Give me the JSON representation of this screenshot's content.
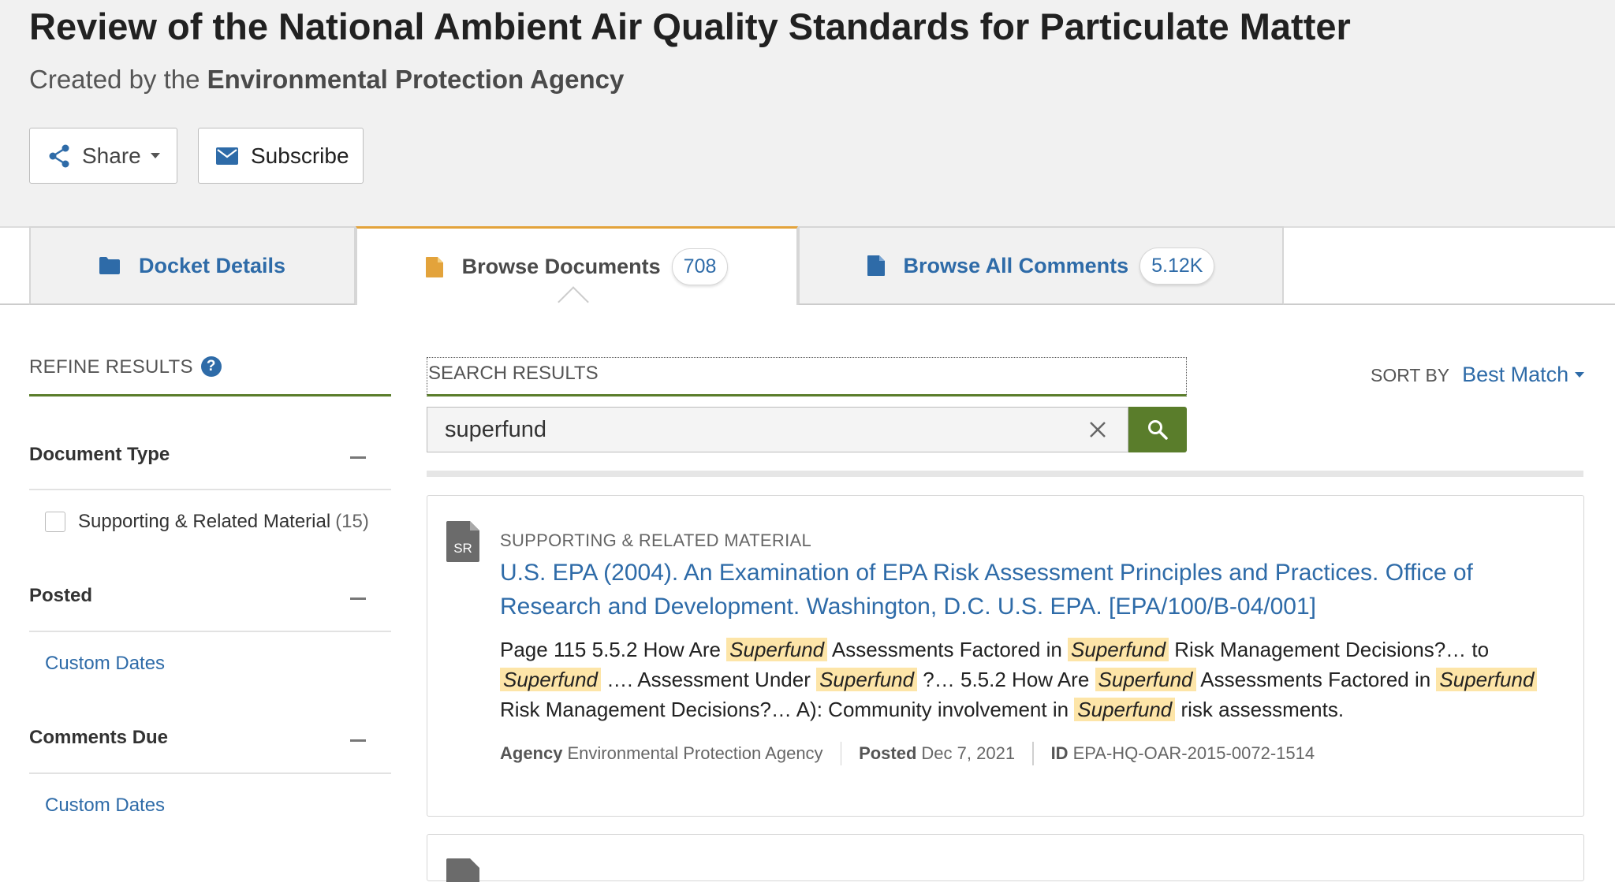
{
  "docket": {
    "title": "Review of the National Ambient Air Quality Standards for Particulate Matter",
    "created_by_prefix": "Created by the",
    "agency": "Environmental Protection Agency"
  },
  "actions": {
    "share_label": "Share",
    "subscribe_label": "Subscribe"
  },
  "tabs": [
    {
      "label": "Docket Details",
      "icon": "folder-icon"
    },
    {
      "label": "Browse Documents",
      "badge": "708",
      "icon": "document-icon",
      "active": true
    },
    {
      "label": "Browse All Comments",
      "badge": "5.12K",
      "icon": "comment-document-icon"
    }
  ],
  "refine": {
    "title": "REFINE RESULTS",
    "help": "?",
    "facets": [
      {
        "label": "Document Type",
        "options": [
          {
            "label": "Supporting & Related Material",
            "count": "(15)"
          }
        ]
      },
      {
        "label": "Posted",
        "link": "Custom Dates"
      },
      {
        "label": "Comments Due",
        "link": "Custom Dates"
      }
    ]
  },
  "search": {
    "label": "SEARCH RESULTS",
    "query": "superfund"
  },
  "sort": {
    "label": "SORT BY",
    "value": "Best Match"
  },
  "results": [
    {
      "icon_label": "SR",
      "type": "SUPPORTING & RELATED MATERIAL",
      "title": "U.S. EPA (2004). An Examination of EPA Risk Assessment Principles and Practices. Office of Research and Development. Washington, D.C. U.S. EPA. [EPA/100/B-04/001]",
      "snippet": {
        "s1": "Page 115 5.5.2 How Are ",
        "h1": "Superfund",
        "s2": " Assessments Factored in ",
        "h2": "Superfund",
        "s3": " Risk Management Decisions?… to ",
        "h3": "Superfund",
        "s4": " …. Assessment Under ",
        "h4": "Superfund",
        "s5": " ?… 5.5.2 How Are ",
        "h5": "Superfund",
        "s6": " Assessments Factored in ",
        "h6": "Superfund",
        "s7": " Risk Management Decisions?… A): Community involvement in ",
        "h7": "Superfund",
        "s8": " risk assessments."
      },
      "meta": {
        "agency_label": "Agency",
        "agency": "Environmental Protection Agency",
        "posted_label": "Posted",
        "posted": "Dec 7, 2021",
        "id_label": "ID",
        "id": "EPA-HQ-OAR-2015-0072-1514"
      }
    }
  ],
  "colors": {
    "link": "#2e6ba8",
    "accent_green": "#5a7d2b",
    "active_tab": "#e3a33b",
    "highlight": "#fde5a8"
  }
}
